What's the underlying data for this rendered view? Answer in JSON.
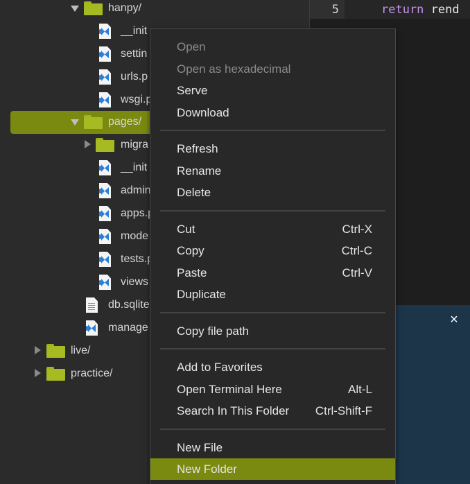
{
  "tree": {
    "rows": [
      {
        "label": "hanpy/",
        "type": "folder",
        "expanded": true
      },
      {
        "label": "__init",
        "type": "py"
      },
      {
        "label": "settin",
        "type": "py"
      },
      {
        "label": "urls.p",
        "type": "py"
      },
      {
        "label": "wsgi.p",
        "type": "py"
      },
      {
        "label": "pages/",
        "type": "folder",
        "expanded": true,
        "selected": true
      },
      {
        "label": "migra",
        "type": "folder",
        "expanded": false
      },
      {
        "label": "__init",
        "type": "py"
      },
      {
        "label": "admin",
        "type": "py"
      },
      {
        "label": "apps.p",
        "type": "py"
      },
      {
        "label": "mode",
        "type": "py"
      },
      {
        "label": "tests.p",
        "type": "py"
      },
      {
        "label": "views",
        "type": "py"
      },
      {
        "label": "db.sqlite",
        "type": "doc"
      },
      {
        "label": "manage",
        "type": "py"
      },
      {
        "label": "live/",
        "type": "folder",
        "expanded": false
      },
      {
        "label": "practice/",
        "type": "folder",
        "expanded": false
      }
    ]
  },
  "editor": {
    "line_number": "5",
    "keyword": "return",
    "identifier": "rend"
  },
  "panel": {
    "close_glyph": "×"
  },
  "context_menu": {
    "groups": [
      [
        {
          "label": "Open",
          "disabled": true
        },
        {
          "label": "Open as hexadecimal",
          "disabled": true
        },
        {
          "label": "Serve"
        },
        {
          "label": "Download"
        }
      ],
      [
        {
          "label": "Refresh"
        },
        {
          "label": "Rename"
        },
        {
          "label": "Delete"
        }
      ],
      [
        {
          "label": "Cut",
          "shortcut": "Ctrl-X"
        },
        {
          "label": "Copy",
          "shortcut": "Ctrl-C"
        },
        {
          "label": "Paste",
          "shortcut": "Ctrl-V"
        },
        {
          "label": "Duplicate"
        }
      ],
      [
        {
          "label": "Copy file path"
        }
      ],
      [
        {
          "label": "Add to Favorites"
        },
        {
          "label": "Open Terminal Here",
          "shortcut": "Alt-L"
        },
        {
          "label": "Search In This Folder",
          "shortcut": "Ctrl-Shift-F"
        }
      ],
      [
        {
          "label": "New File"
        },
        {
          "label": "New Folder",
          "highlighted": true
        }
      ]
    ]
  },
  "colors": {
    "accent": "#7a8a10",
    "folder": "#a6bb22",
    "python_icon": "#2c7fd6",
    "panel": "#1c3549"
  },
  "icons": {
    "folder": "folder-icon",
    "python_file": "python-file-icon",
    "text_file": "text-file-icon",
    "expand": "chevron-down-icon",
    "collapse": "chevron-right-icon",
    "close": "close-icon"
  }
}
